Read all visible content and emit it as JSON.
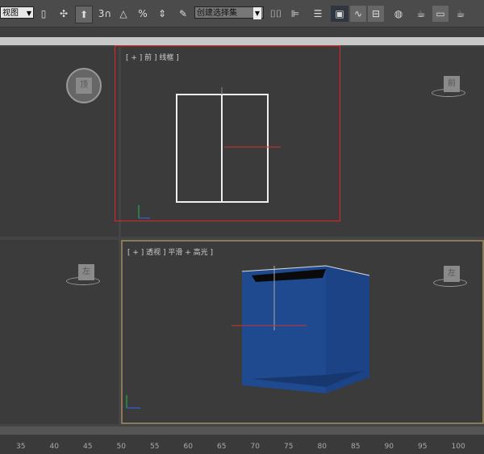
{
  "toolbar": {
    "view_dropdown": "视图",
    "selection_set_dropdown": "创建选择集",
    "icons": [
      "select-link-icon",
      "move-icon",
      "pivot-icon",
      "snap-3d-icon",
      "angle-snap-icon",
      "percent-snap-icon",
      "spinner-snap-icon",
      "edit-named-selection-icon",
      "mirror-icon",
      "align-icon",
      "layer-manager-icon",
      "scene-explorer-icon",
      "curve-editor-icon",
      "schematic-view-icon",
      "material-editor-icon",
      "render-setup-icon",
      "rendered-frame-icon",
      "render-icon"
    ]
  },
  "viewports": {
    "front": {
      "label": "[ + ] 前 ] 线框 ]",
      "gizmo": "前"
    },
    "perspective": {
      "label": "[ + ] 透视 ] 平滑 + 高光 ]",
      "gizmo": "左"
    },
    "top_left": {
      "gizmo": "顶"
    },
    "bottom_left": {
      "gizmo": "左"
    }
  },
  "highlight_color": "#e0262b",
  "box_color": "#1f4a8f",
  "timeline": {
    "ticks": [
      "35",
      "40",
      "45",
      "50",
      "55",
      "60",
      "65",
      "70",
      "75",
      "80",
      "85",
      "90",
      "95",
      "100"
    ]
  }
}
